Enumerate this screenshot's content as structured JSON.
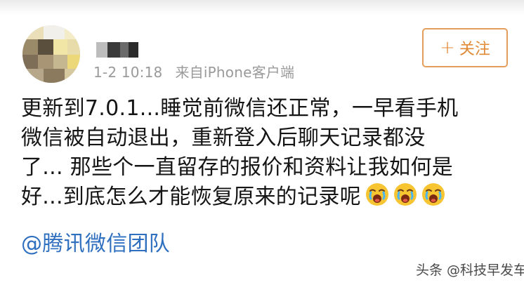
{
  "post": {
    "author": {
      "avatar_icon": "pixelated-avatar-icon",
      "name_hidden": true
    },
    "meta": {
      "date_time": "1-2 10:18",
      "source": "来自iPhone客户端"
    },
    "follow_button": {
      "plus": "+",
      "label": "关注",
      "color": "#e08a35"
    },
    "body_lines": [
      "更新到7.0.1...睡觉前微信还正常，一早看手机",
      "微信被自动退出，重新登入后聊天记录都没",
      "了... 那些个一直留存的报价和资料让我如何是",
      "好...到底怎么才能恢复原来的记录呢"
    ],
    "emojis": [
      "crying-face-emoji",
      "crying-face-emoji",
      "crying-face-emoji"
    ],
    "mention": "@腾讯微信团队",
    "mention_color": "#2f6fbf"
  },
  "watermark": "头条 @科技早发车"
}
